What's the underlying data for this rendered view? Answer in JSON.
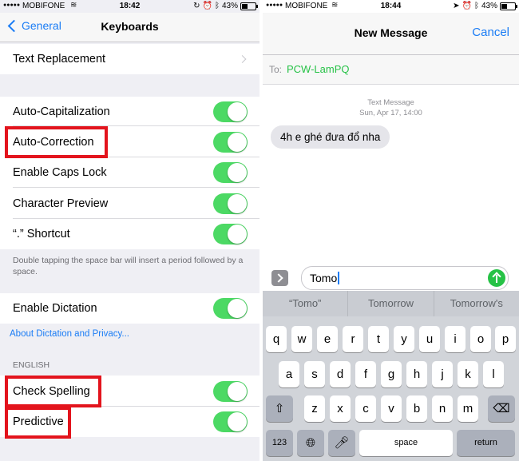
{
  "left": {
    "status": {
      "carrier": "MOBIFONE",
      "time": "18:42",
      "battery": "43%",
      "battery_fraction": 0.43
    },
    "nav": {
      "back_label": "General",
      "title": "Keyboards"
    },
    "rows": {
      "text_replacement": "Text Replacement",
      "auto_capitalization": "Auto-Capitalization",
      "auto_correction": "Auto-Correction",
      "caps_lock": "Enable Caps Lock",
      "char_preview": "Character Preview",
      "shortcut": "“.” Shortcut",
      "enable_dictation": "Enable Dictation",
      "check_spelling": "Check Spelling",
      "predictive": "Predictive"
    },
    "toggles_on": true,
    "footnote": "Double tapping the space bar will insert a period followed by a space.",
    "dictation_link": "About Dictation and Privacy...",
    "section_english": "ENGLISH"
  },
  "right": {
    "status": {
      "carrier": "MOBIFONE",
      "time": "18:44",
      "battery": "43%",
      "battery_fraction": 0.43
    },
    "nav": {
      "title": "New Message",
      "cancel_label": "Cancel"
    },
    "to_label": "To:",
    "recipient": "PCW-LamPQ",
    "meta_kind": "Text Message",
    "meta_time": "Sun, Apr 17, 14:00",
    "message": "4h e ghé đưa đổ nha",
    "input_value": "Tomo",
    "suggestions": [
      "“Tomo”",
      "Tomorrow",
      "Tomorrow's"
    ],
    "keys": {
      "row1": [
        "q",
        "w",
        "e",
        "r",
        "t",
        "y",
        "u",
        "i",
        "o",
        "p"
      ],
      "row2": [
        "a",
        "s",
        "d",
        "f",
        "g",
        "h",
        "j",
        "k",
        "l"
      ],
      "row3": [
        "z",
        "x",
        "c",
        "v",
        "b",
        "n",
        "m"
      ],
      "numbers": "123",
      "space": "space",
      "return": "return"
    }
  },
  "colors": {
    "accent": "#1a7cf5",
    "toggle_on": "#4cd964",
    "highlight": "#e3141d",
    "recipient": "#26c246"
  }
}
